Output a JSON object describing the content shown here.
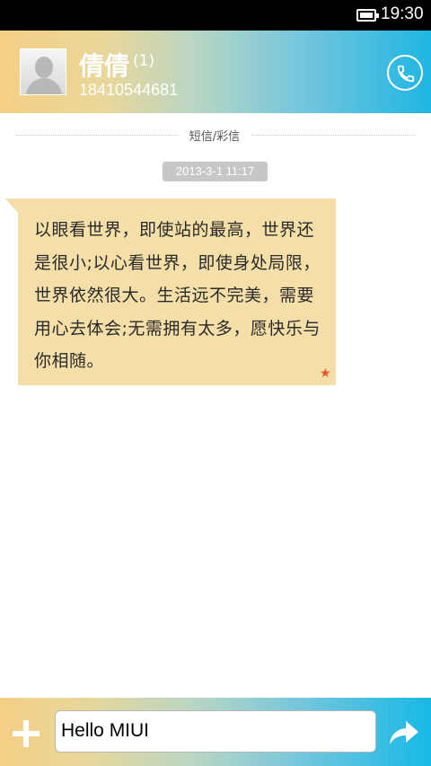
{
  "status_bar": {
    "time": "19:30"
  },
  "header": {
    "contact_name": "倩倩",
    "message_count": "(1)",
    "phone_number": "18410544681"
  },
  "thread": {
    "message_type": "短信/彩信",
    "timestamp": "2013-3-1 11:17",
    "message_text": "以眼看世界，即使站的最高，世界还是很小;以心看世界，即使身处局限，世界依然很大。生活远不完美，需要用心去体会;无需拥有太多，愿快乐与你相随。",
    "starred": true
  },
  "composer": {
    "input_value": "Hello MIUI"
  },
  "colors": {
    "bubble": "#f5dfa8",
    "star": "#ee5522",
    "accent": "#1fb6e2"
  }
}
